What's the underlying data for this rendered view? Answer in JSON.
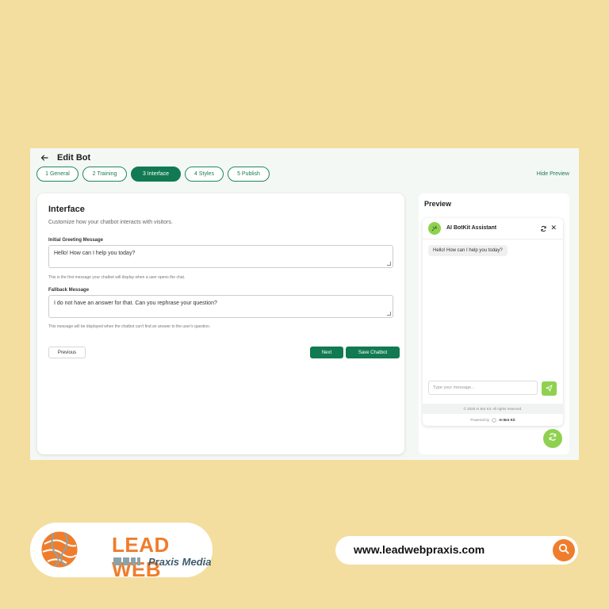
{
  "header": {
    "title": "Edit Bot"
  },
  "tabs": [
    {
      "label": "1 General"
    },
    {
      "label": "2 Training"
    },
    {
      "label": "3 Interface",
      "active": true
    },
    {
      "label": "4 Styles"
    },
    {
      "label": "5 Publish"
    }
  ],
  "hide_preview": "Hide Preview",
  "card": {
    "title": "Interface",
    "subtitle": "Customize how your chatbot interacts with visitors.",
    "greeting": {
      "label": "Initial Greeting Message",
      "value": "Hello! How can I help you today?",
      "hint": "This is the first message your chatbot will display when a user opens the chat."
    },
    "fallback": {
      "label": "Fallback Message",
      "value": "I do not have an answer for that. Can you rephrase your question?",
      "hint": "This message will be displayed when the chatbot can't find an answer to the user's question."
    },
    "buttons": {
      "previous": "Previous",
      "next": "Next",
      "save": "Save Chatbot"
    }
  },
  "preview": {
    "title": "Preview",
    "bot_name": "AI BotKit Assistant",
    "greeting_message": "Hello! How can I help you today?",
    "input_placeholder": "Type your message...",
    "copyright": "© 2025 AI Bot Kit. All rights reserved.",
    "powered_by_label": "Powered by",
    "powered_by_brand": "AI Bot Kit"
  },
  "footer": {
    "brand_line1": "LEAD WEB",
    "brand_line2": "Praxis Media",
    "url": "www.leadwebpraxis.com"
  },
  "colors": {
    "background": "#f3de9f",
    "primary_green": "#117a52",
    "accent_lime": "#8fd14f",
    "brand_orange": "#ef7d2c"
  },
  "icons": {
    "back": "arrow-left-icon",
    "bot": "bot-icon",
    "refresh": "refresh-icon",
    "close": "close-icon",
    "send": "send-icon",
    "fab": "chat-toggle-icon",
    "search": "search-icon",
    "globe": "globe-logo-icon"
  }
}
